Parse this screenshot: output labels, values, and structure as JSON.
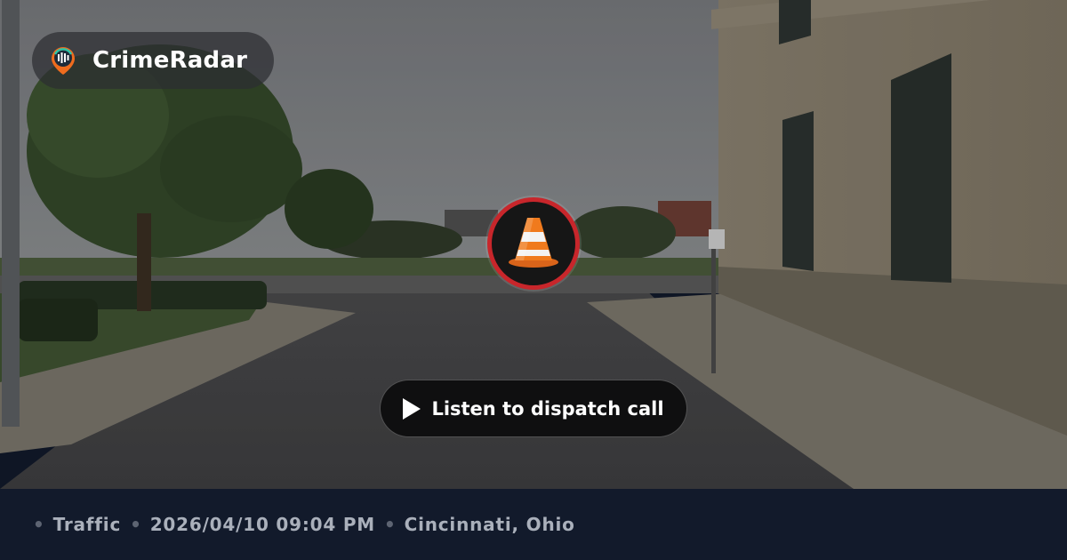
{
  "brand": {
    "name": "CrimeRadar",
    "logo_icon": "radar-pin-icon"
  },
  "incident": {
    "category_icon": "traffic-cone-icon",
    "category": "Traffic",
    "datetime": "2026/04/10 09:04 PM",
    "location": "Cincinnati, Ohio",
    "separator": "•"
  },
  "actions": {
    "listen_label": "Listen to dispatch call",
    "listen_icon": "play-icon"
  },
  "colors": {
    "badge_ring": "#c8262b",
    "cone_orange": "#f07a1d",
    "info_bar_bg": "#121a2b",
    "info_text": "#aab0bb"
  }
}
